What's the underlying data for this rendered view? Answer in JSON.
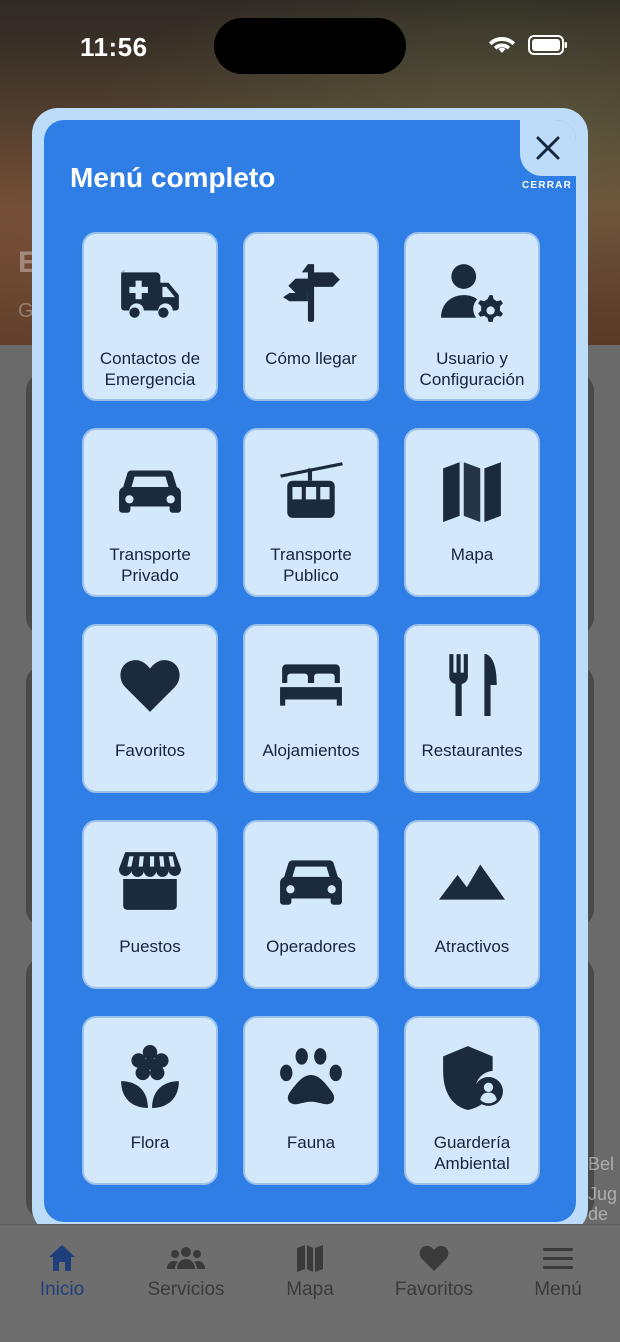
{
  "status_bar": {
    "time": "11:56"
  },
  "background": {
    "hero_initial": "E",
    "hero_sub_initial": "G",
    "side_text_1": "Bel",
    "side_text_2": "Jug",
    "side_text_3": "de"
  },
  "modal": {
    "title": "Menú completo",
    "close_label": "CERRAR",
    "items": [
      {
        "label": "Contactos de\nEmergencia",
        "icon": "ambulance-icon"
      },
      {
        "label": "Cómo llegar",
        "icon": "signpost-icon"
      },
      {
        "label": "Usuario y\nConfiguración",
        "icon": "user-gear-icon"
      },
      {
        "label": "Transporte\nPrivado",
        "icon": "car-icon"
      },
      {
        "label": "Transporte\nPublico",
        "icon": "cable-car-icon"
      },
      {
        "label": "Mapa",
        "icon": "map-icon"
      },
      {
        "label": "Favoritos",
        "icon": "heart-icon"
      },
      {
        "label": "Alojamientos",
        "icon": "bed-icon"
      },
      {
        "label": "Restaurantes",
        "icon": "utensils-icon"
      },
      {
        "label": "Puestos",
        "icon": "shop-icon"
      },
      {
        "label": "Operadores",
        "icon": "car-front-icon"
      },
      {
        "label": "Atractivos",
        "icon": "mountains-icon"
      },
      {
        "label": "Flora",
        "icon": "flower-icon"
      },
      {
        "label": "Fauna",
        "icon": "paw-icon"
      },
      {
        "label": "Guardería\nAmbiental",
        "icon": "shield-user-icon"
      }
    ]
  },
  "tabbar": {
    "tabs": [
      {
        "label": "Inicio",
        "icon": "home-icon",
        "active": true
      },
      {
        "label": "Servicios",
        "icon": "users-icon",
        "active": false
      },
      {
        "label": "Mapa",
        "icon": "map-icon",
        "active": false
      },
      {
        "label": "Favoritos",
        "icon": "heart-icon",
        "active": false
      },
      {
        "label": "Menú",
        "icon": "hamburger-icon",
        "active": false
      }
    ]
  },
  "colors": {
    "modal_bg": "#2f7ee6",
    "modal_frame": "#bcdcfa",
    "tile_bg": "#d4e8fb",
    "icon": "#1b2a3c",
    "tab_active": "#1e3f7a"
  }
}
